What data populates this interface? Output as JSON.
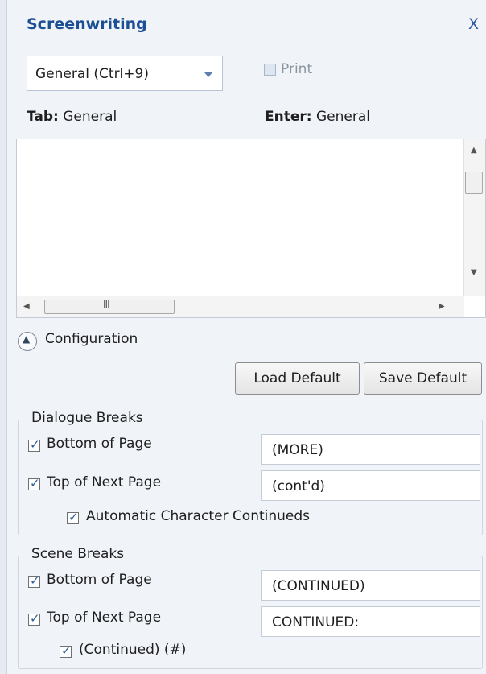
{
  "panel": {
    "title": "Screenwriting",
    "close_label": "X"
  },
  "element_select": {
    "value": "General (Ctrl+9)"
  },
  "print": {
    "label": "Print",
    "checked": false,
    "enabled": false
  },
  "tab_info": {
    "key": "Tab:",
    "value": "General"
  },
  "enter_info": {
    "key": "Enter:",
    "value": "General"
  },
  "listbox": {
    "items": [],
    "hscroll_grip": "III"
  },
  "configuration": {
    "label": "Configuration",
    "expanded": true,
    "load_default": "Load Default",
    "save_default": "Save Default"
  },
  "dialogue_breaks": {
    "title": "Dialogue Breaks",
    "bottom_of_page": {
      "label": "Bottom of Page",
      "checked": true,
      "value": "(MORE)"
    },
    "top_of_next_page": {
      "label": "Top of Next Page",
      "checked": true,
      "value": "(cont'd)"
    },
    "auto_continueds": {
      "label": "Automatic Character Continueds",
      "checked": true
    }
  },
  "scene_breaks": {
    "title": "Scene Breaks",
    "bottom_of_page": {
      "label": "Bottom of Page",
      "checked": true,
      "value": "(CONTINUED)"
    },
    "top_of_next_page": {
      "label": "Top of Next Page",
      "checked": true,
      "value": "CONTINUED:"
    },
    "continued_number": {
      "label": "(Continued) (#)",
      "checked": true
    }
  },
  "colors": {
    "title_blue": "#1d4f94",
    "panel_bg": "#f0f4f9",
    "check_blue": "#2e5d9e"
  }
}
